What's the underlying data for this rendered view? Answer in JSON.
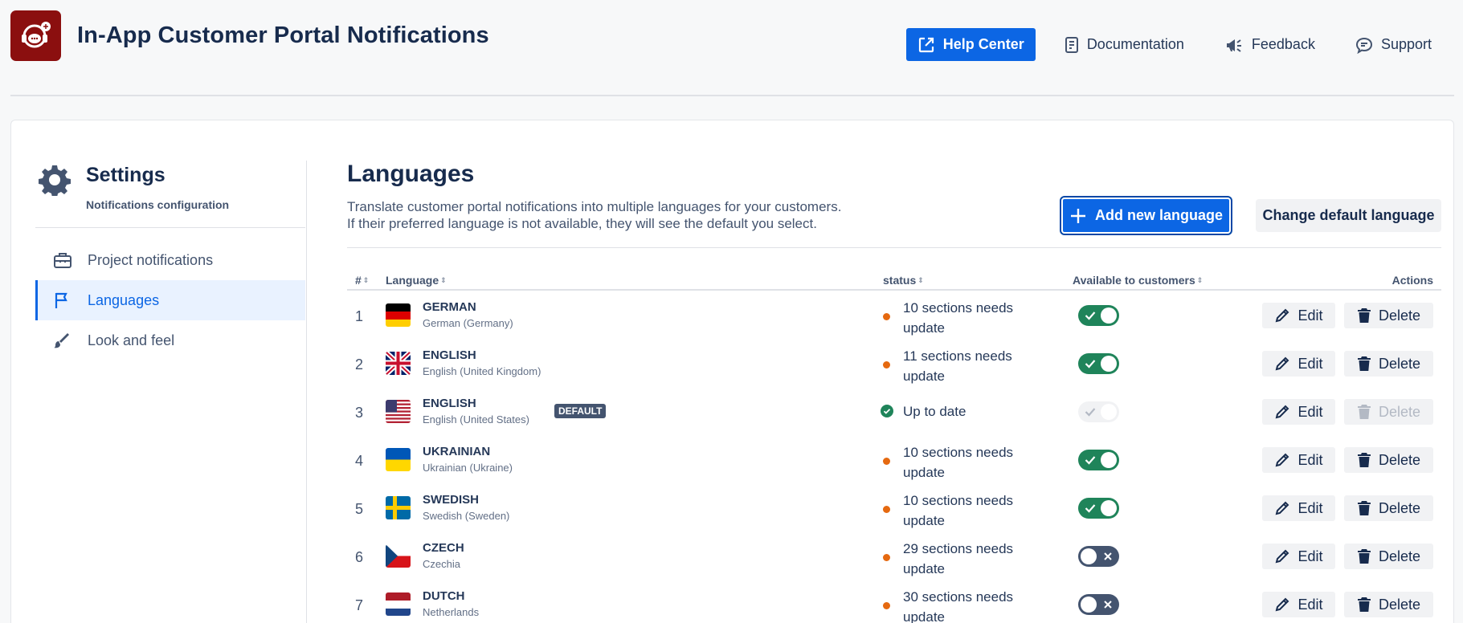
{
  "app": {
    "title": "In-App Customer Portal Notifications"
  },
  "header_nav": {
    "help_center": "Help Center",
    "documentation": "Documentation",
    "feedback": "Feedback",
    "support": "Support"
  },
  "sidebar": {
    "title": "Settings",
    "subtitle": "Notifications configuration",
    "items": [
      {
        "label": "Project notifications",
        "icon": "briefcase-icon",
        "active": false
      },
      {
        "label": "Languages",
        "icon": "flag-icon",
        "active": true
      },
      {
        "label": "Look and feel",
        "icon": "brush-icon",
        "active": false
      }
    ]
  },
  "main": {
    "title": "Languages",
    "desc_line1": "Translate customer portal notifications into multiple languages for your customers.",
    "desc_line2": "If their preferred language is not available, they will see the default you select.",
    "add_button": "Add new language",
    "change_default_button": "Change default language"
  },
  "table": {
    "headers": {
      "num": "#",
      "language": "Language",
      "status": "status",
      "available": "Available to customers",
      "actions": "Actions"
    },
    "edit_label": "Edit",
    "delete_label": "Delete",
    "default_badge": "DEFAULT",
    "rows": [
      {
        "num": "1",
        "name": "GERMAN",
        "locale": "German (Germany)",
        "flag": "de",
        "status_line1": "10 sections needs",
        "status_line2": "update",
        "status_type": "warn",
        "available": "on",
        "is_default": false
      },
      {
        "num": "2",
        "name": "ENGLISH",
        "locale": "English (United Kingdom)",
        "flag": "gb",
        "status_line1": "11 sections needs",
        "status_line2": "update",
        "status_type": "warn",
        "available": "on",
        "is_default": false
      },
      {
        "num": "3",
        "name": "ENGLISH",
        "locale": "English (United States)",
        "flag": "us",
        "status_line1": "Up to date",
        "status_line2": "",
        "status_type": "ok",
        "available": "disabled",
        "is_default": true
      },
      {
        "num": "4",
        "name": "UKRAINIAN",
        "locale": "Ukrainian (Ukraine)",
        "flag": "ua",
        "status_line1": "10 sections needs",
        "status_line2": "update",
        "status_type": "warn",
        "available": "on",
        "is_default": false
      },
      {
        "num": "5",
        "name": "SWEDISH",
        "locale": "Swedish (Sweden)",
        "flag": "se",
        "status_line1": "10 sections needs",
        "status_line2": "update",
        "status_type": "warn",
        "available": "on",
        "is_default": false
      },
      {
        "num": "6",
        "name": "CZECH",
        "locale": "Czechia",
        "flag": "cz",
        "status_line1": "29 sections needs",
        "status_line2": "update",
        "status_type": "warn",
        "available": "off",
        "is_default": false
      },
      {
        "num": "7",
        "name": "DUTCH",
        "locale": "Netherlands",
        "flag": "nl",
        "status_line1": "30 sections needs",
        "status_line2": "update",
        "status_type": "warn",
        "available": "off",
        "is_default": false
      }
    ]
  },
  "colors": {
    "primary": "#0c66e4",
    "success": "#1f845a",
    "warning": "#e56910",
    "logo_bg": "#8b0f0f"
  }
}
